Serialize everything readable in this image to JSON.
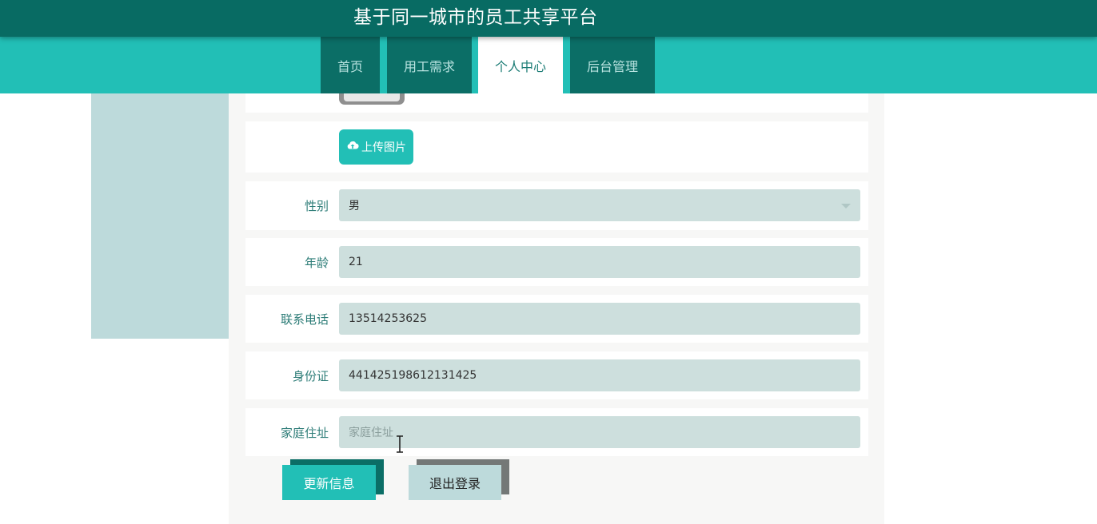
{
  "header": {
    "title": "基于同一城市的员工共享平台"
  },
  "nav": {
    "tabs": [
      {
        "label": "首页",
        "active": false
      },
      {
        "label": "用工需求",
        "active": false
      },
      {
        "label": "个人中心",
        "active": true
      },
      {
        "label": "后台管理",
        "active": false
      }
    ]
  },
  "form": {
    "upload_label": "上传图片",
    "gender": {
      "label": "性别",
      "value": "男"
    },
    "age": {
      "label": "年龄",
      "value": "21"
    },
    "phone": {
      "label": "联系电话",
      "value": "13514253625"
    },
    "id_card": {
      "label": "身份证",
      "value": "441425198612131425"
    },
    "address": {
      "label": "家庭住址",
      "value": "",
      "placeholder": "家庭住址"
    }
  },
  "actions": {
    "update_label": "更新信息",
    "logout_label": "退出登录"
  },
  "colors": {
    "header_bg": "#086b63",
    "nav_bg": "#22bfb6",
    "tab_bg": "#0b6e66",
    "accent": "#22bfb6",
    "field_bg": "#cddfdd"
  },
  "icons": {
    "upload": "cloud-upload-icon",
    "cursor": "text-cursor-icon",
    "select": "chevron-down-icon"
  }
}
